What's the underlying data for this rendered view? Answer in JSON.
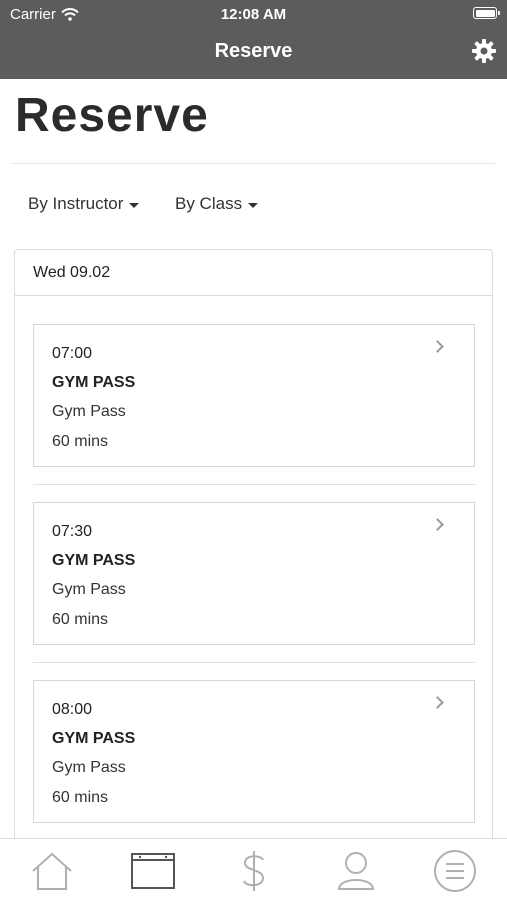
{
  "status_bar": {
    "carrier": "Carrier",
    "time": "12:08 AM"
  },
  "nav": {
    "title": "Reserve",
    "settings_icon": "gear-icon"
  },
  "page": {
    "title": "Reserve"
  },
  "filters": {
    "instructor_label": "By Instructor",
    "class_label": "By Class"
  },
  "schedule": {
    "date": "Wed 09.02",
    "classes": [
      {
        "time": "07:00",
        "name": "GYM PASS",
        "subtitle": "Gym Pass",
        "duration": "60 mins"
      },
      {
        "time": "07:30",
        "name": "GYM PASS",
        "subtitle": "Gym Pass",
        "duration": "60 mins"
      },
      {
        "time": "08:00",
        "name": "GYM PASS",
        "subtitle": "Gym Pass",
        "duration": "60 mins"
      }
    ]
  },
  "tabbar": {
    "tabs": [
      {
        "icon": "home-icon",
        "active": false
      },
      {
        "icon": "calendar-icon",
        "active": true
      },
      {
        "icon": "dollar-icon",
        "active": false
      },
      {
        "icon": "user-icon",
        "active": false
      },
      {
        "icon": "menu-icon",
        "active": false
      }
    ]
  },
  "colors": {
    "header_bg": "#5c5c5c",
    "active_icon": "#555555",
    "inactive_icon": "#b0b0b0"
  }
}
